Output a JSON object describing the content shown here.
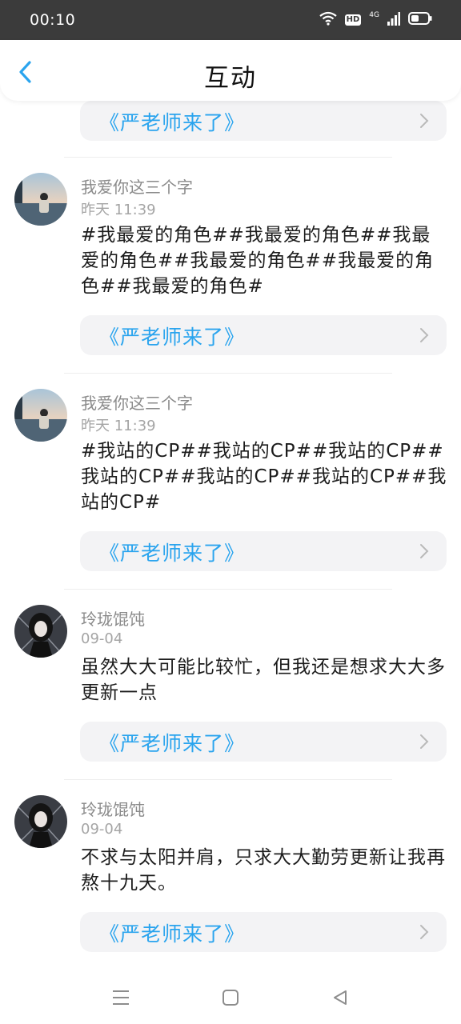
{
  "status_bar": {
    "time": "00:10",
    "hd_label": "HD",
    "network_label": "4G"
  },
  "header": {
    "title": "互动"
  },
  "top_book": {
    "title": "《严老师来了》"
  },
  "comments": [
    {
      "username": "我爱你这三个字",
      "time": "昨天 11:39",
      "text": "#我最爱的角色##我最爱的角色##我最爱的角色##我最爱的角色##我最爱的角色##我最爱的角色#",
      "book": "《严老师来了》"
    },
    {
      "username": "我爱你这三个字",
      "time": "昨天 11:39",
      "text": "#我站的CP##我站的CP##我站的CP##我站的CP##我站的CP##我站的CP##我站的CP#",
      "book": "《严老师来了》"
    },
    {
      "username": "玲珑馄饨",
      "time": "09-04",
      "text": "虽然大大可能比较忙，但我还是想求大大多更新一点",
      "book": "《严老师来了》"
    },
    {
      "username": "玲珑馄饨",
      "time": "09-04",
      "text": "不求与太阳并肩，只求大大勤劳更新让我再熬十九天。",
      "book": "《严老师来了》"
    }
  ],
  "colors": {
    "accent": "#2aa4ee",
    "status_bar": "#3b3b3b"
  }
}
